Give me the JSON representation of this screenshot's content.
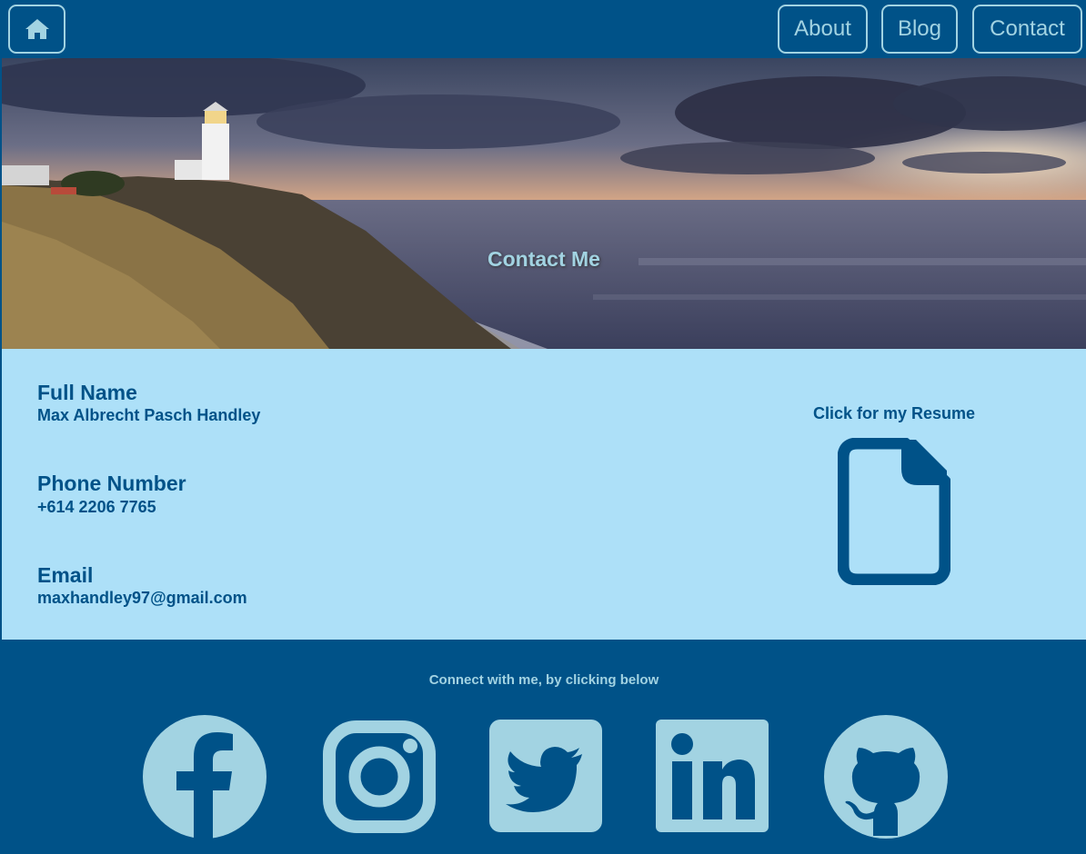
{
  "nav": {
    "home_icon": "home-icon",
    "items": [
      {
        "label": "About"
      },
      {
        "label": "Blog"
      },
      {
        "label": "Contact"
      }
    ]
  },
  "hero": {
    "title": "Contact Me"
  },
  "contact": {
    "fields": [
      {
        "label": "Full Name",
        "value": "Max Albrecht Pasch Handley"
      },
      {
        "label": "Phone Number",
        "value": "+614 2206 7765"
      },
      {
        "label": "Email",
        "value": "maxhandley97@gmail.com"
      }
    ],
    "resume": {
      "label": "Click for my Resume",
      "icon": "file-icon"
    }
  },
  "footer": {
    "text": "Connect with me, by clicking below",
    "socials": [
      "facebook-icon",
      "instagram-icon",
      "twitter-icon",
      "linkedin-icon",
      "github-icon"
    ]
  },
  "colors": {
    "primary": "#005288",
    "accent": "#a2d3e2",
    "panel": "#ade0f8"
  }
}
